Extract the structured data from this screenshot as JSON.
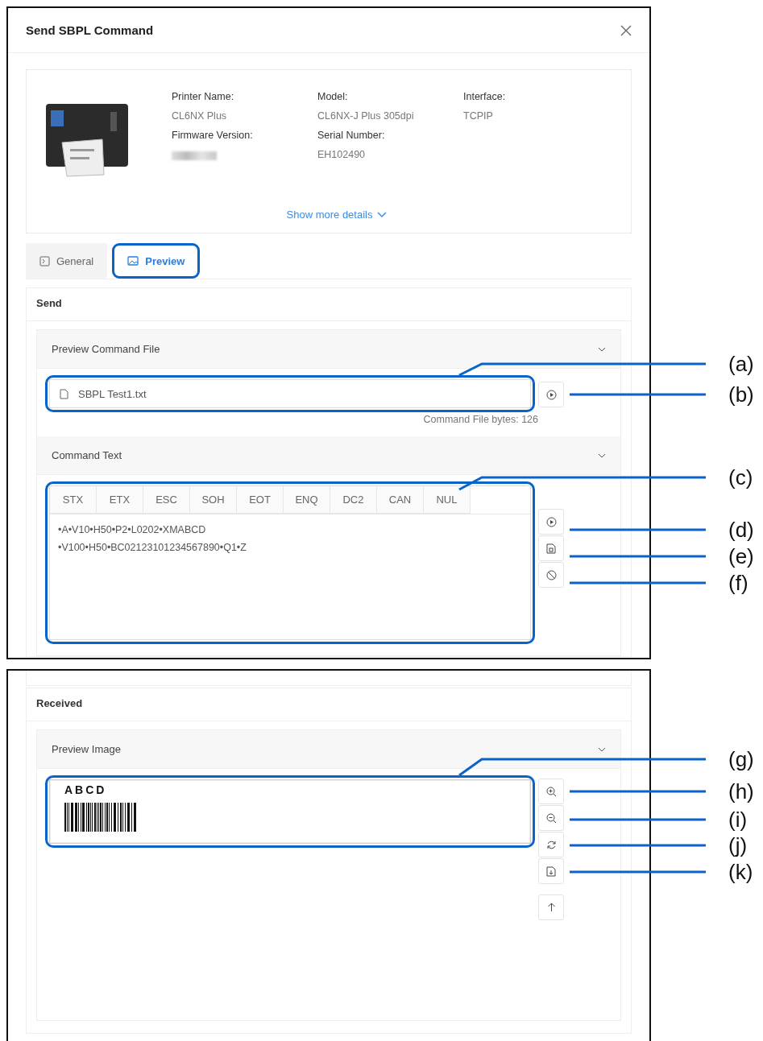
{
  "dialog": {
    "title": "Send SBPL Command"
  },
  "printer": {
    "fields": [
      {
        "label": "Printer Name:",
        "kind": "text",
        "value": "CL6NX Plus"
      },
      {
        "label": "Model:",
        "kind": "text",
        "value": "CL6NX-J Plus 305dpi"
      },
      {
        "label": "Interface:",
        "kind": "text",
        "value": "TCPIP"
      },
      {
        "label": "Firmware Version:",
        "kind": "blurred"
      },
      {
        "label": "Serial Number:",
        "kind": "text",
        "value": "EH102490"
      }
    ],
    "show_more": "Show more details"
  },
  "tabs": [
    {
      "label": "General",
      "selected": false,
      "highlighted": false
    },
    {
      "label": "Preview",
      "selected": true,
      "highlighted": true
    }
  ],
  "send": {
    "title": "Send",
    "file_panel": {
      "title": "Preview Command File",
      "file_name": "SBPL Test1.txt",
      "highlighted": true,
      "bytes": "Command File bytes: 126"
    },
    "command_panel": {
      "title": "Command Text",
      "highlighted": true,
      "keys": [
        "STX",
        "ETX",
        "ESC",
        "SOH",
        "EOT",
        "ENQ",
        "DC2",
        "CAN",
        "NUL"
      ],
      "lines": [
        "•A•V10•H50•P2•L0202•XMABCD",
        "•V100•H50•BC02123101234567890•Q1•Z"
      ]
    }
  },
  "received": {
    "title": "Received",
    "image_panel": {
      "title": "Preview Image",
      "highlighted": true,
      "label_text": "ABCD"
    }
  },
  "callouts": [
    "(a)",
    "(b)",
    "(c)",
    "(d)",
    "(e)",
    "(f)",
    "(g)",
    "(h)",
    "(i)",
    "(j)",
    "(k)"
  ]
}
